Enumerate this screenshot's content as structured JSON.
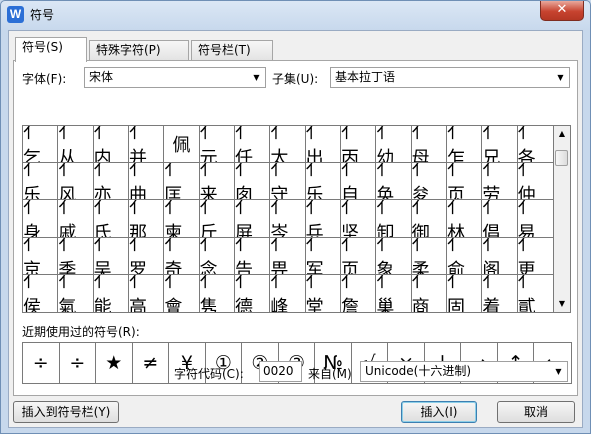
{
  "window": {
    "app_icon": "W",
    "title": "符号",
    "close_glyph": "✕"
  },
  "tabs": [
    {
      "label": "符号(S)",
      "active": true
    },
    {
      "label": "特殊字符(P)",
      "active": false
    },
    {
      "label": "符号栏(T)",
      "active": false
    }
  ],
  "font": {
    "label": "字体(F):",
    "value": "宋体"
  },
  "subset": {
    "label": "子集(U):",
    "value": "基本拉丁语"
  },
  "symbols": [
    [
      "亻乞",
      "亻从",
      "亻内",
      "亻并",
      "佩",
      "亻元",
      "亻任",
      "亻太",
      "亻出",
      "亻丙",
      "亻幼",
      "亻母",
      "亻乍",
      "亻兄",
      "亻各"
    ],
    [
      "亻乐",
      "亻风",
      "亻亦",
      "亻曲",
      "亻匡",
      "亻来",
      "亻囱",
      "亻守",
      "亻乐",
      "亻自",
      "亻奂",
      "亻夋",
      "亻页",
      "亻劳",
      "亻仲"
    ],
    [
      "亻身",
      "亻戚",
      "亻氐",
      "亻那",
      "亻柬",
      "亻斤",
      "亻屏",
      "亻岑",
      "亻兵",
      "亻坚",
      "亻卸",
      "亻御",
      "亻林",
      "亻倡",
      "亻易"
    ],
    [
      "亻京",
      "亻季",
      "亻吴",
      "亻罗",
      "亻奇",
      "亻念",
      "亻告",
      "亻畀",
      "亻军",
      "亻页",
      "亻象",
      "亻柔",
      "亻俞",
      "亻阁",
      "亻更"
    ],
    [
      "亻侯",
      "亻氣",
      "亻能",
      "亻高",
      "亻會",
      "亻隽",
      "亻德",
      "亻峰",
      "亻堂",
      "亻詹",
      "亻巢",
      "亻商",
      "亻固",
      "亻着",
      "亻貳"
    ]
  ],
  "recent": {
    "label": "近期使用过的符号(R):",
    "symbols": [
      "÷",
      "÷",
      "★",
      "≠",
      "¥",
      "①",
      "②",
      "③",
      "№",
      "√",
      "×",
      "↓",
      "→",
      "↑",
      "←"
    ]
  },
  "char_code": {
    "label": "字符代码(C):",
    "value": "0020"
  },
  "from": {
    "label": "来自(M)",
    "value": "Unicode(十六进制)"
  },
  "buttons": {
    "insert_to_bar": "插入到符号栏(Y)",
    "insert": "插入(I)",
    "cancel": "取消"
  }
}
